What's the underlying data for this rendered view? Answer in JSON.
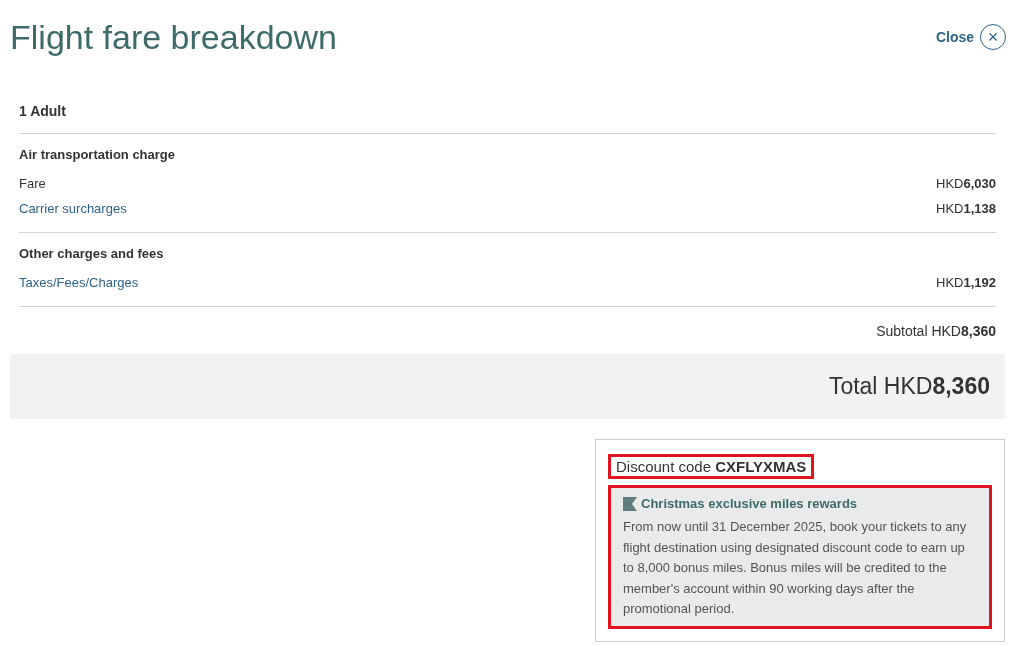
{
  "title": "Flight fare breakdown",
  "close": {
    "label": "Close",
    "icon": "×"
  },
  "passengers": "1 Adult",
  "sections": [
    {
      "heading": "Air transportation charge",
      "rows": [
        {
          "label": "Fare",
          "kind": "plain",
          "amount": "HKD**6,030**"
        },
        {
          "label": "Carrier surcharges",
          "kind": "link",
          "amount": "HKD**1,138**"
        }
      ]
    },
    {
      "heading": "Other charges and fees",
      "rows": [
        {
          "label": "Taxes/Fees/Charges",
          "kind": "link",
          "amount": "HKD**1,192**"
        }
      ]
    }
  ],
  "subtotal": "Subtotal HKD**8,360**",
  "total": "Total HKD**8,360**",
  "discount": {
    "text": "Discount code **CXFLYXMAS**",
    "highlighted": true
  },
  "promo": {
    "title": "Christmas exclusive miles rewards",
    "body": "From now until 31 December 2025, book your tickets to any flight destination using designated discount code to earn up to 8,000 bonus miles. Bonus miles will be credited to the member's account within 90 working days after the promotional period.",
    "highlighted": true
  }
}
